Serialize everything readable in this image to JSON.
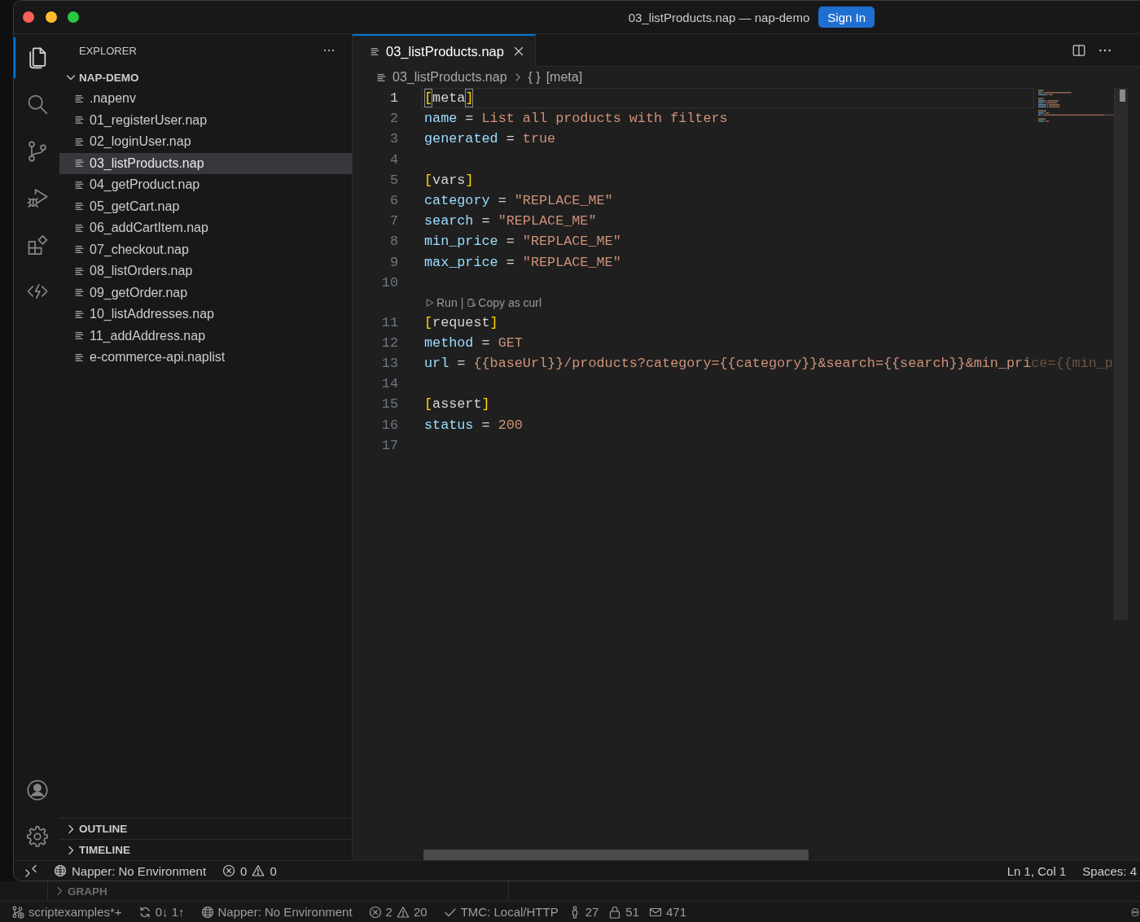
{
  "window": {
    "title": "03_listProducts.nap — nap-demo",
    "sign_in": "Sign In"
  },
  "activity_bar": {
    "items": [
      {
        "selected": true
      },
      {
        "selected": false
      },
      {
        "selected": false
      },
      {
        "selected": false
      },
      {
        "selected": false
      },
      {
        "selected": false
      }
    ]
  },
  "sidebar": {
    "title": "EXPLORER",
    "folder": {
      "name": "NAP-DEMO",
      "expanded": true,
      "files": [
        {
          "name": ".napenv",
          "selected": false
        },
        {
          "name": "01_registerUser.nap",
          "selected": false
        },
        {
          "name": "02_loginUser.nap",
          "selected": false
        },
        {
          "name": "03_listProducts.nap",
          "selected": true
        },
        {
          "name": "04_getProduct.nap",
          "selected": false
        },
        {
          "name": "05_getCart.nap",
          "selected": false
        },
        {
          "name": "06_addCartItem.nap",
          "selected": false
        },
        {
          "name": "07_checkout.nap",
          "selected": false
        },
        {
          "name": "08_listOrders.nap",
          "selected": false
        },
        {
          "name": "09_getOrder.nap",
          "selected": false
        },
        {
          "name": "10_listAddresses.nap",
          "selected": false
        },
        {
          "name": "11_addAddress.nap",
          "selected": false
        },
        {
          "name": "e-commerce-api.naplist",
          "selected": false
        }
      ]
    },
    "sections": [
      {
        "title": "OUTLINE",
        "expanded": false
      },
      {
        "title": "TIMELINE",
        "expanded": false
      }
    ]
  },
  "editor": {
    "tabs": [
      {
        "label": "03_listProducts.nap",
        "selected": true
      }
    ],
    "breadcrumbs": {
      "file": "03_listProducts.nap",
      "symbol_icon": "{ }",
      "symbol": "[meta]"
    },
    "lines": [
      {
        "number": "1",
        "active": true,
        "tokens": [
          {
            "kind": "bracket",
            "text": "["
          },
          {
            "kind": "section",
            "text": "meta"
          },
          {
            "kind": "bracket",
            "text": "]"
          }
        ]
      },
      {
        "number": "2",
        "active": false,
        "tokens": [
          {
            "kind": "key",
            "text": "name"
          },
          {
            "kind": "op",
            "text": " = "
          },
          {
            "kind": "value",
            "text": "List all products with filters"
          }
        ]
      },
      {
        "number": "3",
        "active": false,
        "tokens": [
          {
            "kind": "key",
            "text": "generated"
          },
          {
            "kind": "op",
            "text": " = "
          },
          {
            "kind": "value",
            "text": "true"
          }
        ]
      },
      {
        "number": "4",
        "active": false
      },
      {
        "number": "5",
        "active": false,
        "tokens": [
          {
            "kind": "bracket",
            "text": "["
          },
          {
            "kind": "section",
            "text": "vars"
          },
          {
            "kind": "bracket",
            "text": "]"
          }
        ]
      },
      {
        "number": "6",
        "active": false,
        "tokens": [
          {
            "kind": "key",
            "text": "category"
          },
          {
            "kind": "op",
            "text": " = "
          },
          {
            "kind": "value",
            "text": "\"REPLACE_ME\""
          }
        ]
      },
      {
        "number": "7",
        "active": false,
        "tokens": [
          {
            "kind": "key",
            "text": "search"
          },
          {
            "kind": "op",
            "text": " = "
          },
          {
            "kind": "value",
            "text": "\"REPLACE_ME\""
          }
        ]
      },
      {
        "number": "8",
        "active": false,
        "tokens": [
          {
            "kind": "key",
            "text": "min_price"
          },
          {
            "kind": "op",
            "text": " = "
          },
          {
            "kind": "value",
            "text": "\"REPLACE_ME\""
          }
        ]
      },
      {
        "number": "9",
        "active": false,
        "tokens": [
          {
            "kind": "key",
            "text": "max_price"
          },
          {
            "kind": "op",
            "text": " = "
          },
          {
            "kind": "value",
            "text": "\"REPLACE_ME\""
          }
        ]
      },
      {
        "number": "10",
        "active": false
      },
      {
        "number": "11",
        "active": false,
        "codelens": {
          "actions": [
            "Run",
            "Copy as curl"
          ],
          "separator": "|"
        },
        "tokens": [
          {
            "kind": "bracket",
            "text": "["
          },
          {
            "kind": "section",
            "text": "request"
          },
          {
            "kind": "bracket",
            "text": "]"
          }
        ]
      },
      {
        "number": "12",
        "active": false,
        "tokens": [
          {
            "kind": "key",
            "text": "method"
          },
          {
            "kind": "op",
            "text": " = "
          },
          {
            "kind": "value",
            "text": "GET"
          }
        ]
      },
      {
        "number": "13",
        "active": false,
        "tokens": [
          {
            "kind": "key",
            "text": "url"
          },
          {
            "kind": "op",
            "text": " = "
          },
          {
            "kind": "value",
            "text": "{{baseUrl}}/products?category={{category}}&search={{search}}&min_pri"
          },
          {
            "kind": "faded",
            "text": "ce={{min_p"
          }
        ]
      },
      {
        "number": "14",
        "active": false
      },
      {
        "number": "15",
        "active": false,
        "tokens": [
          {
            "kind": "bracket",
            "text": "["
          },
          {
            "kind": "section",
            "text": "assert"
          },
          {
            "kind": "bracket",
            "text": "]"
          }
        ]
      },
      {
        "number": "16",
        "active": false,
        "tokens": [
          {
            "kind": "key",
            "text": "status"
          },
          {
            "kind": "op",
            "text": " = "
          },
          {
            "kind": "value",
            "text": "200"
          }
        ]
      },
      {
        "number": "17",
        "active": false
      }
    ]
  },
  "status_bar": {
    "environment": "Napper: No Environment",
    "errors": "0",
    "warnings": "0",
    "cursor": "Ln 1, Col 1",
    "indentation": "Spaces: 4"
  },
  "background_window": {
    "section": {
      "title": "GRAPH",
      "expanded": false
    },
    "status_bar": {
      "branch": "scriptexamples*+",
      "sync": "0↓ 1↑",
      "environment": "Napper: No Environment",
      "errors": "2",
      "warnings": "20",
      "tests": "TMC: Local/HTTP",
      "people": "27",
      "locks": "51",
      "mail": "471"
    }
  }
}
